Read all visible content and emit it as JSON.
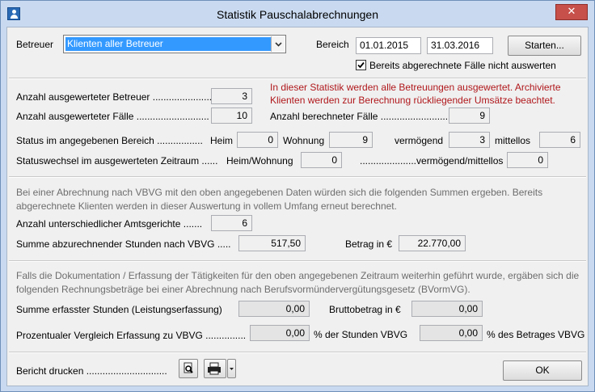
{
  "window": {
    "title": "Statistik Pauschalabrechnungen",
    "close_glyph": "✕"
  },
  "top": {
    "betreuer_label": "Betreuer",
    "betreuer_value": "Klienten aller Betreuer",
    "bereich_label": "Bereich",
    "date_from": "01.01.2015",
    "date_to": "31.03.2016",
    "start_button": "Starten...",
    "exclude_checkbox_label": "Bereits abgerechnete Fälle nicht auswerten",
    "exclude_checked": true
  },
  "section1": {
    "info_text": "In dieser Statistik werden alle Betreuungen ausgewertet. Archivierte Klienten werden zur Berechnung rückliegender Umsätze beachtet.",
    "anzahl_betreuer_label": "Anzahl ausgewerteter Betreuer ......................",
    "anzahl_betreuer_value": "3",
    "anzahl_faelle_label": "Anzahl ausgewerteter Fälle ...........................",
    "anzahl_faelle_value": "10",
    "berechnete_faelle_label": "Anzahl berechneter Fälle ...........................",
    "berechnete_faelle_value": "9",
    "status_label": "Status im angegebenen Bereich .................",
    "heim_label": "Heim",
    "heim_value": "0",
    "wohnung_label": "Wohnung",
    "wohnung_value": "9",
    "vermoegend_label": "vermögend",
    "vermoegend_value": "3",
    "mittellos_label": "mittellos",
    "mittellos_value": "6",
    "statuswechsel_label": "Statuswechsel im ausgewerteten Zeitraum ......",
    "heim_wohnung_label": "Heim/Wohnung",
    "heim_wohnung_value": "0",
    "verm_mittellos_label": ".....................vermögend/mittellos",
    "verm_mittellos_value": "0"
  },
  "section2": {
    "info_text": "Bei einer Abrechnung nach VBVG mit den oben angegebenen Daten würden sich die folgenden Summen ergeben. Bereits abgerechnete Klienten werden in dieser Auswertung in vollem Umfang erneut berechnet.",
    "amtsgerichte_label": "Anzahl unterschiedlicher Amtsgerichte .......",
    "amtsgerichte_value": "6",
    "stunden_label": "Summe abzurechnender Stunden nach VBVG .....",
    "stunden_value": "517,50",
    "betrag_label": "Betrag in €",
    "betrag_value": "22.770,00"
  },
  "section3": {
    "info_text": "Falls die Dokumentation / Erfassung der Tätigkeiten für den oben angegebenen Zeitraum weiterhin geführt wurde, ergäben sich die folgenden Rechnungsbeträge bei einer Abrechnung nach Berufsvormündervergütungsgesetz (BVormVG).",
    "erfasste_label": "Summe erfasster Stunden (Leistungserfassung)",
    "erfasste_value": "0,00",
    "brutto_label": "Bruttobetrag in €",
    "brutto_value": "0,00",
    "vergleich_label": "Prozentualer Vergleich Erfassung zu VBVG ...............",
    "vergleich_stunden_value": "0,00",
    "vergleich_stunden_suffix": "% der Stunden VBVG",
    "vergleich_betrag_value": "0,00",
    "vergleich_betrag_suffix": "% des Betrages VBVG"
  },
  "footer": {
    "bericht_label": "Bericht drucken ..............................",
    "preview_icon": "print-preview-icon",
    "print_icon": "printer-icon",
    "ok_button": "OK"
  }
}
